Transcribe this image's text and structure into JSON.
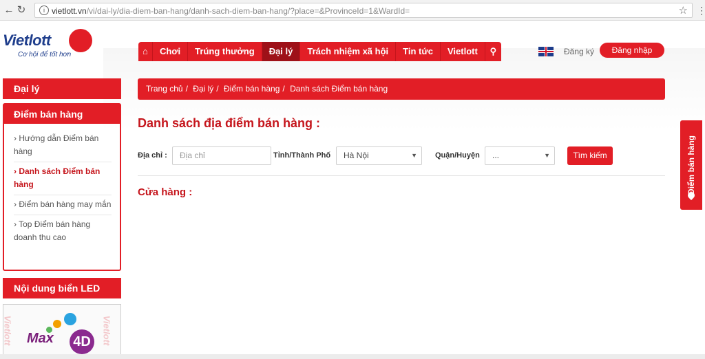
{
  "browser": {
    "url_host": "vietlott.vn",
    "url_path": "/vi/dai-ly/dia-diem-ban-hang/danh-sach-diem-ban-hang/?place=&ProvinceId=1&WardId="
  },
  "brand": {
    "logo_text": "Vietlott",
    "tagline": "Cơ hội để tốt hơn",
    "primary_color": "#e21e26",
    "dark_red": "#9e1118",
    "logo_blue": "#1f3e8c"
  },
  "nav": {
    "items": [
      "Chơi",
      "Trúng thưởng",
      "Đại lý",
      "Trách nhiệm xã hội",
      "Tin tức",
      "Vietlott"
    ],
    "active": "Đại lý"
  },
  "header": {
    "register": "Đăng ký",
    "login": "Đăng nhập"
  },
  "sidebar": {
    "section_agent": "Đại lý",
    "section_points": "Điểm bán hàng",
    "links": [
      "› Hướng dẫn Điểm bán hàng",
      "› Danh sách Điểm bán hàng",
      "› Điểm bán hàng may mắn",
      "› Top Điểm bán hàng doanh thu cao"
    ],
    "section_led": "Nội dung biển LED",
    "led_watermark": "Vietlott",
    "led_max": "Max",
    "led_4d": "4D"
  },
  "breadcrumb": [
    "Trang chủ",
    "Đại lý",
    "Điểm bán hàng",
    "Danh sách Điểm bán hàng"
  ],
  "main": {
    "title": "Danh sách địa điểm bán hàng :",
    "address_label": "Địa chỉ :",
    "address_placeholder": "Địa chỉ",
    "province_label": "Tỉnh/Thành Phố",
    "province_value": "Hà Nội",
    "district_label": "Quận/Huyện",
    "district_value": "...",
    "search_button": "Tìm kiếm",
    "stores_label": "Cửa hàng :"
  },
  "side_tab": {
    "label": "Điểm bán hàng"
  }
}
